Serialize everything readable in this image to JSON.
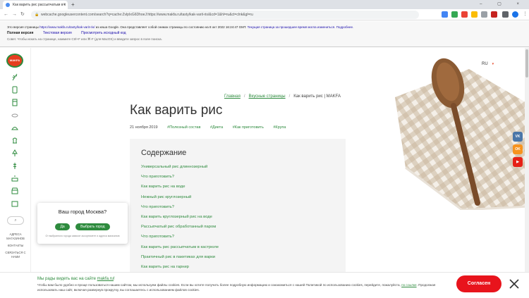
{
  "browser": {
    "tab_title": "Как варить рис рассыпчатым в к",
    "tab_close": "×",
    "new_tab": "+",
    "window_controls": "– ▢ ×",
    "url": "webcache.googleusercontent.com/search?q=cache:ZvlpIxG6DhoeJ:https://www.makfa.ru/tasty/kak-varit-ris/&cd=1&hl=ru&ct=clnk&gl=ru",
    "back": "←",
    "forward": "→",
    "reload": "↻"
  },
  "cache_notice": {
    "line1_prefix": "Это версия страницы ",
    "line1_link": "https://www.makfa.ru/tasty/kak-varit-ris/",
    "line1_suffix": " из кеша Google. Она представляет собой снимок страницы по состоянию на 8 окт 2022 16:24:47 GMT. ",
    "line1_link2": "Текущая страница за прошедшее время могла измениться. Подробнее.",
    "full_version": "Полная версия",
    "text_version": "Текстовая версия",
    "view_source": "Просмотреть исходный код",
    "tip": "Совет. Чтобы искать на странице, нажмите Ctrl+F или ⌘-F (для MacOS) и введите запрос в поле поиска."
  },
  "sidebar": {
    "logo_text": "MAKFA",
    "search_icon": "⌕",
    "links": [
      "АДРЕСА МАГАЗИНОВ",
      "КОНТАКТЫ",
      "СВЯЗАТЬСЯ С НАМИ"
    ]
  },
  "lang": {
    "label": "RU",
    "chevron": "▾"
  },
  "breadcrumb": {
    "home": "Главная",
    "sep1": "/",
    "tasty": "Вкусные страницы",
    "sep2": "/",
    "current": "Как варить рис | MAKFA"
  },
  "article": {
    "title": "Как варить рис",
    "date": "21 ноября 2019",
    "tags": [
      "#Полезный состав",
      "#Диета",
      "#Как приготовить",
      "#Крупа"
    ]
  },
  "toc": {
    "title": "Содержание",
    "items": [
      "Универсальный рис длиннозерный",
      "Что приготовить?",
      "Как варить рис на воде",
      "Нежный рис круглозерный",
      "Что приготовить?",
      "Как варить круглозерный рис на воде",
      "Рассыпчатый рис обработанный паром",
      "Что приготовить?",
      "Как варить рис рассыпчатым в кастрюле",
      "Практичный рис в пакетиках для варки",
      "Как варить рис на гарнир"
    ]
  },
  "social": {
    "vk": "VK",
    "ok": "OK",
    "yt": "▶"
  },
  "city_popup": {
    "question": "Ваш город Москва?",
    "yes": "Да",
    "choose": "Выбрать город",
    "hint": "От выбранного города зависят ассортимент и адреса магазинов"
  },
  "cookie": {
    "title_prefix": "Мы рады видеть вас на сайте ",
    "title_link": "makfa.ru",
    "title_suffix": "!",
    "text_1": "Чтобы вам было удобно и проще пользоваться нашим сайтом, мы используем файлы cookies. Если вы хотите получить более подробную информацию и ознакомиться с нашей Политикой по использованию cookies, перейдите, пожалуйста, ",
    "text_link": "по ссылке",
    "text_2": ". Продолжая использовать наш сайт, включая развернув прокрутку, вы соглашаетесь с использованием файлов cookies.",
    "agree": "Согласен"
  },
  "colors": {
    "brand_green": "#2e8b3e",
    "brand_red": "#e8141c",
    "vk": "#4a76a8",
    "ok": "#f7931e",
    "youtube": "#e62117"
  }
}
